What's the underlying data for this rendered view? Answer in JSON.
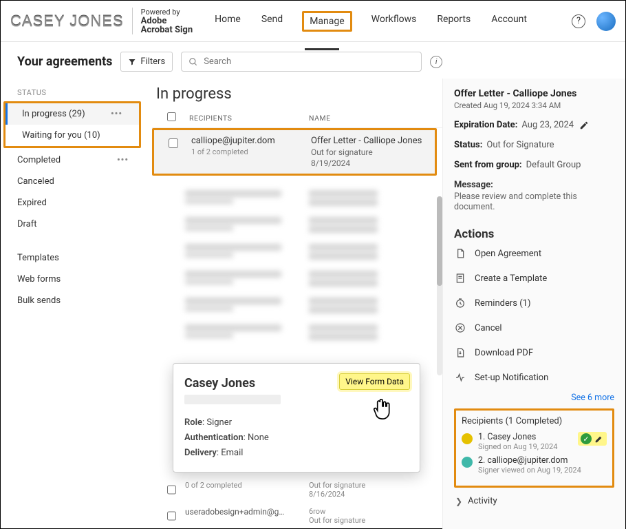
{
  "top": {
    "logo": "CASEY JONES",
    "powered_label": "Powered by",
    "powered_product": "Adobe\nAcrobat Sign",
    "nav": {
      "home": "Home",
      "send": "Send",
      "manage": "Manage",
      "workflows": "Workflows",
      "reports": "Reports",
      "account": "Account"
    }
  },
  "subbar": {
    "title": "Your agreements",
    "filters_label": "Filters",
    "search_placeholder": "Search"
  },
  "sidebar": {
    "status_heading": "STATUS",
    "in_progress": "In progress (29)",
    "waiting": "Waiting for you (10)",
    "completed": "Completed",
    "canceled": "Canceled",
    "expired": "Expired",
    "draft": "Draft",
    "templates": "Templates",
    "webforms": "Web forms",
    "bulk": "Bulk sends"
  },
  "content": {
    "title": "In progress",
    "col_recipients": "RECIPIENTS",
    "col_name": "NAME",
    "row1": {
      "recipient": "calliope@jupiter.dom",
      "recipient_sub": "1 of 2 completed",
      "name": "Offer Letter - Calliope Jones",
      "name_sub1": "Out for signature",
      "name_sub2": "8/19/2024"
    },
    "tail_row_a": {
      "sub": "0 of 2 completed",
      "n1": "Out for signature",
      "n2": "8/16/2024"
    },
    "tail_row_b": {
      "recipient": "useradobesign+admin@g…",
      "n1": "6row",
      "n2": "Out for signature"
    }
  },
  "popover": {
    "name": "Casey Jones",
    "view_form_data": "View Form Data",
    "role_label": "Role",
    "role_value": "Signer",
    "auth_label": "Authentication",
    "auth_value": "None",
    "delivery_label": "Delivery",
    "delivery_value": "Email"
  },
  "right": {
    "title": "Offer Letter - Calliope Jones",
    "created": "Created Aug 19, 2024 3:34 AM",
    "expiration_label": "Expiration Date:",
    "expiration_value": "Aug 23, 2024",
    "status_label": "Status:",
    "status_value": "Out for Signature",
    "sent_label": "Sent from group:",
    "sent_value": "Default Group",
    "message_label": "Message:",
    "message_value": "Please review and complete this document.",
    "actions_title": "Actions",
    "action_open": "Open Agreement",
    "action_template": "Create a Template",
    "action_reminders": "Reminders (1)",
    "action_cancel": "Cancel",
    "action_download": "Download PDF",
    "action_notif": "Set-up Notification",
    "see_more": "See 6 more",
    "recipients_title": "Recipients (1 Completed)",
    "recip1_name": "1. Casey Jones",
    "recip1_sub": "Signed on Aug 19, 2024",
    "recip2_name": "2. calliope@jupiter.dom",
    "recip2_sub": "Signer viewed on Aug 19, 2024",
    "activity": "Activity"
  }
}
